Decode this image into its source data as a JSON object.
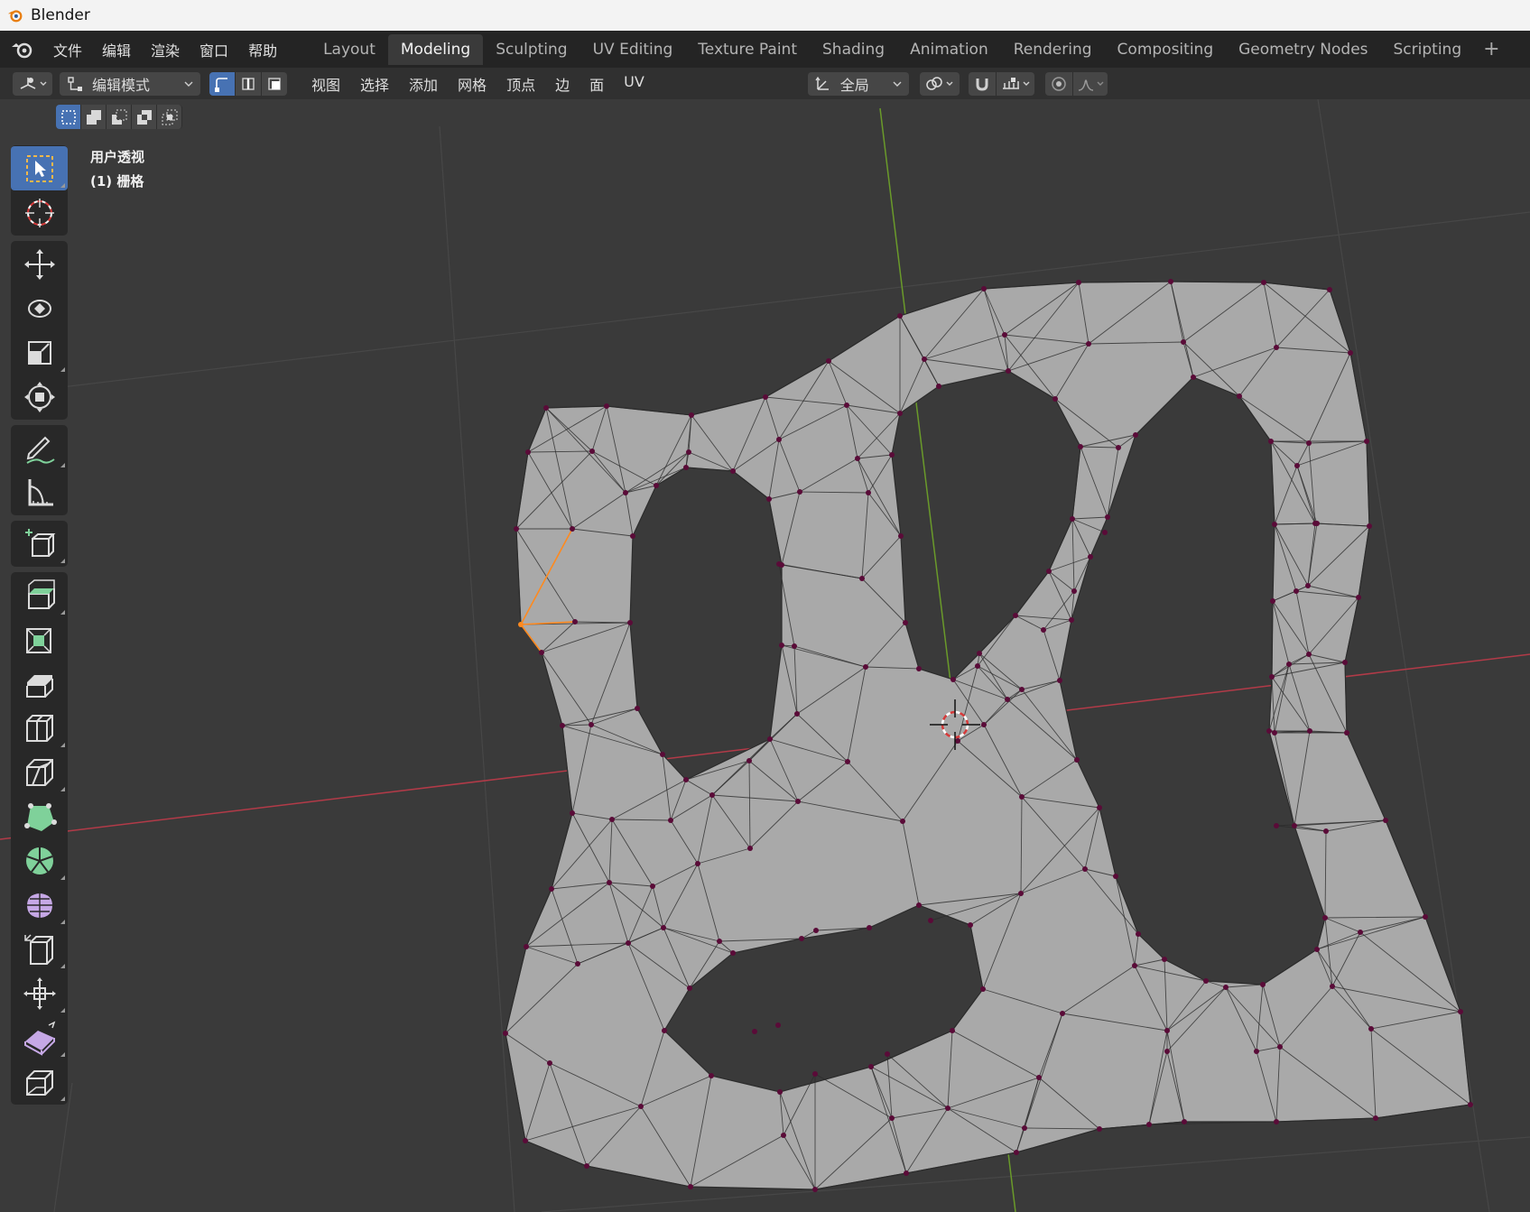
{
  "window": {
    "title": "Blender",
    "logo_icon": "blender-logo-icon"
  },
  "menubar": {
    "items": [
      "文件",
      "编辑",
      "渲染",
      "窗口",
      "帮助"
    ]
  },
  "workspaces": {
    "tabs": [
      "Layout",
      "Modeling",
      "Sculpting",
      "UV Editing",
      "Texture Paint",
      "Shading",
      "Animation",
      "Rendering",
      "Compositing",
      "Geometry Nodes",
      "Scripting"
    ],
    "active": "Modeling",
    "add_label": "+"
  },
  "header": {
    "mode_label": "编辑模式",
    "viewport_menu": [
      "视图",
      "选择",
      "添加",
      "网格",
      "顶点",
      "边",
      "面",
      "UV"
    ],
    "transform_orientation": "全局"
  },
  "viewport": {
    "view_name": "用户透视",
    "object_name": "(1) 栅格",
    "colors": {
      "background": "#3a3a3a",
      "mesh_face": "#a9a9a9",
      "mesh_edge": "#2c2c2c",
      "vertex": "#5a0b38",
      "selected": "#ff8a1f",
      "x_axis": "#b23a48",
      "y_axis": "#6a9a2a",
      "accent": "#4772b3"
    }
  },
  "toolbar": {
    "tools": [
      "select-box-icon",
      "cursor-icon",
      "move-icon",
      "rotate-icon",
      "scale-icon",
      "transform-icon",
      "annotate-icon",
      "measure-icon",
      "add-cube-icon",
      "extrude-region-icon",
      "inset-faces-icon",
      "bevel-icon",
      "loop-cut-icon",
      "knife-icon",
      "poly-build-icon",
      "spin-icon",
      "smooth-icon",
      "edge-slide-icon",
      "shrink-fatten-icon",
      "shear-icon",
      "rip-region-icon"
    ],
    "active": "select-box-icon"
  }
}
